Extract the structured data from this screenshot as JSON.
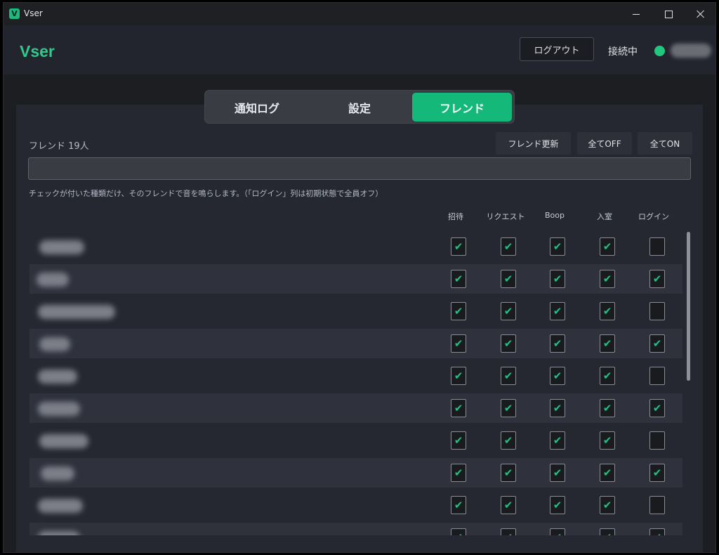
{
  "window": {
    "title": "Vser",
    "icon_letter": "V"
  },
  "header": {
    "brand": "Vser",
    "logout_label": "ログアウト",
    "status": "接続中",
    "status_color": "#22c77e"
  },
  "tabs": [
    {
      "label": "通知ログ"
    },
    {
      "label": "設定"
    },
    {
      "label": "フレンド"
    }
  ],
  "active_tab": "フレンド",
  "friends": {
    "count_label": "フレンド 19人",
    "refresh_label": "フレンド更新",
    "all_off_label": "全てOFF",
    "all_on_label": "全てON",
    "search_value": "",
    "hint": "チェックが付いた種類だけ、そのフレンドで音を鳴らします。（「ログイン」列は初期状態で全員オフ）",
    "columns": [
      "招待",
      "リクエスト",
      "Boop",
      "入室",
      "ログイン"
    ],
    "rows": [
      {
        "checks": [
          true,
          true,
          true,
          true,
          false
        ]
      },
      {
        "checks": [
          true,
          true,
          true,
          true,
          true
        ]
      },
      {
        "checks": [
          true,
          true,
          true,
          true,
          false
        ]
      },
      {
        "checks": [
          true,
          true,
          true,
          true,
          true
        ]
      },
      {
        "checks": [
          true,
          true,
          true,
          true,
          false
        ]
      },
      {
        "checks": [
          true,
          true,
          true,
          true,
          true
        ]
      },
      {
        "checks": [
          true,
          true,
          true,
          true,
          false
        ]
      },
      {
        "checks": [
          true,
          true,
          true,
          true,
          true
        ]
      },
      {
        "checks": [
          true,
          true,
          true,
          true,
          false
        ]
      },
      {
        "checks": [
          true,
          true,
          true,
          true,
          true
        ]
      }
    ]
  },
  "colors": {
    "accent": "#14b97a",
    "check": "#1ec283",
    "brand": "#2fc98b"
  },
  "icons": {
    "app": "app-icon",
    "minimize": "minimize-icon",
    "maximize": "maximize-icon",
    "close": "close-icon",
    "check": "checkmark-icon"
  }
}
